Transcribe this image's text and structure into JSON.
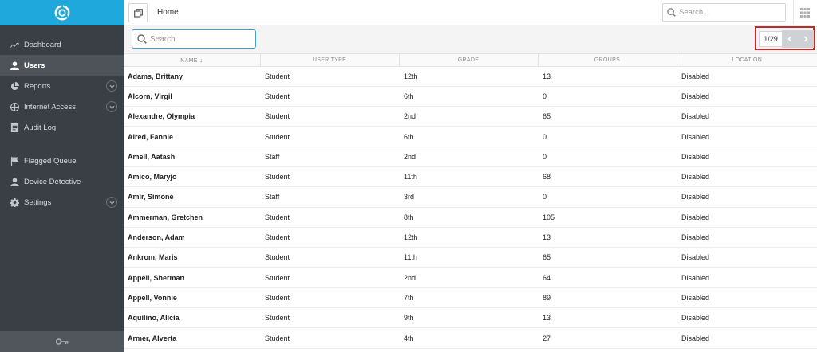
{
  "colors": {
    "sidebar_bg": "#3a3f45",
    "logo_bg": "#1fa8dc",
    "active_item": "#4d5359",
    "focus_border": "#3ea3d8",
    "highlight": "#c62828"
  },
  "sidebar": {
    "logo_icon": "lifebuoy-logo-icon",
    "items": [
      {
        "label": "Dashboard",
        "icon": "chart-line-icon",
        "active": false,
        "expandable": false
      },
      {
        "label": "Users",
        "icon": "user-icon",
        "active": true,
        "expandable": false
      },
      {
        "label": "Reports",
        "icon": "pie-chart-icon",
        "active": false,
        "expandable": true
      },
      {
        "label": "Internet Access",
        "icon": "globe-icon",
        "active": false,
        "expandable": true
      },
      {
        "label": "Audit Log",
        "icon": "log-icon",
        "active": false,
        "expandable": false
      }
    ],
    "items2": [
      {
        "label": "Flagged Queue",
        "icon": "flag-icon",
        "active": false,
        "expandable": false
      },
      {
        "label": "Device Detective",
        "icon": "user-icon",
        "active": false,
        "expandable": false
      },
      {
        "label": "Settings",
        "icon": "gear-icon",
        "active": false,
        "expandable": true
      }
    ],
    "footer_icon": "key-icon"
  },
  "topbar": {
    "breadcrumb": "Home",
    "search_placeholder": "Search...",
    "window_icon": "restore-window-icon",
    "apps_icon": "app-grid-icon"
  },
  "toolbar": {
    "search_placeholder": "Search",
    "pager": "1/29"
  },
  "table": {
    "columns": [
      "NAME",
      "USER TYPE",
      "GRADE",
      "GROUPS",
      "LOCATION"
    ],
    "sort_indicator": "↓",
    "rows": [
      [
        "Adams, Brittany",
        "Student",
        "12th",
        "13",
        "Disabled"
      ],
      [
        "Alcorn, Virgil",
        "Student",
        "6th",
        "0",
        "Disabled"
      ],
      [
        "Alexandre, Olympia",
        "Student",
        "2nd",
        "65",
        "Disabled"
      ],
      [
        "Alred, Fannie",
        "Student",
        "6th",
        "0",
        "Disabled"
      ],
      [
        "Amell, Aatash",
        "Staff",
        "2nd",
        "0",
        "Disabled"
      ],
      [
        "Amico, Maryjo",
        "Student",
        "11th",
        "68",
        "Disabled"
      ],
      [
        "Amir, Simone",
        "Staff",
        "3rd",
        "0",
        "Disabled"
      ],
      [
        "Ammerman, Gretchen",
        "Student",
        "8th",
        "105",
        "Disabled"
      ],
      [
        "Anderson, Adam",
        "Student",
        "12th",
        "13",
        "Disabled"
      ],
      [
        "Ankrom, Maris",
        "Student",
        "11th",
        "65",
        "Disabled"
      ],
      [
        "Appell, Sherman",
        "Student",
        "2nd",
        "64",
        "Disabled"
      ],
      [
        "Appell, Vonnie",
        "Student",
        "7th",
        "89",
        "Disabled"
      ],
      [
        "Aquilino, Alicia",
        "Student",
        "9th",
        "13",
        "Disabled"
      ],
      [
        "Armer, Alverta",
        "Student",
        "4th",
        "27",
        "Disabled"
      ]
    ]
  }
}
